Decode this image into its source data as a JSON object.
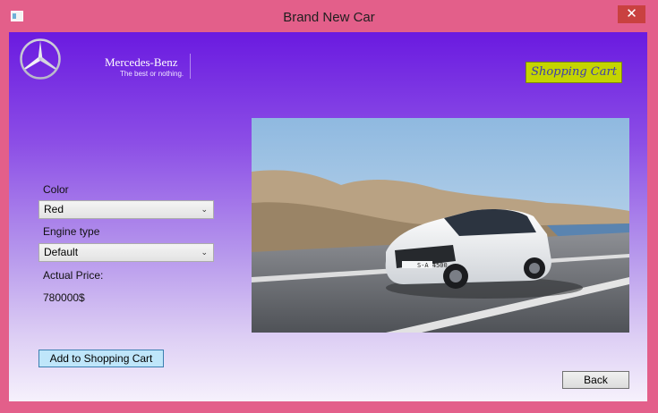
{
  "window": {
    "title": "Brand New Car",
    "close_glyph": "✕",
    "app_icon": "window-icon"
  },
  "brand": {
    "logo_icon": "mercedes-star-icon",
    "name": "Mercedes-Benz",
    "tagline": "The best or nothing."
  },
  "header": {
    "cart_button_label": "Shopping Cart",
    "cart_button_color": "#c4d400"
  },
  "form": {
    "color_label": "Color",
    "color_value": "Red",
    "engine_label": "Engine type",
    "engine_value": "Default",
    "price_label": "Actual Price:",
    "price_value": "780000$",
    "dropdown_icon": "chevron-down-icon"
  },
  "actions": {
    "add_to_cart_label": "Add to Shopping Cart",
    "back_label": "Back"
  },
  "car_image": {
    "plate_text": "S-A 4500"
  },
  "colors": {
    "window_frame": "#e35f8a",
    "gradient_top": "#6a1ae0",
    "gradient_bottom": "#f6f1fc",
    "add_button": "#bfe6fa"
  }
}
